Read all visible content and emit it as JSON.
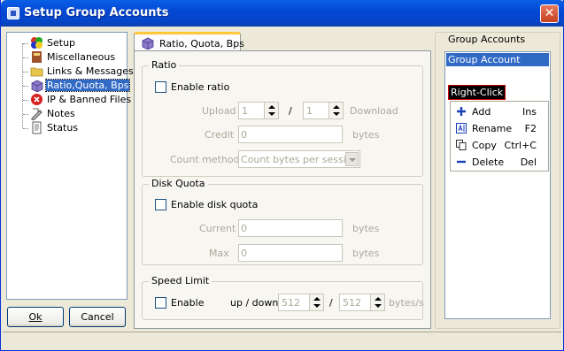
{
  "window": {
    "title": "Setup Group Accounts",
    "close_glyph": "✕"
  },
  "nav": {
    "items": [
      {
        "label": "Setup",
        "icon": "setup-icon"
      },
      {
        "label": "Miscellaneous",
        "icon": "book-icon"
      },
      {
        "label": "Links & Messages",
        "icon": "folder-icon"
      },
      {
        "label": "Ratio,Quota, Bps",
        "icon": "box-icon",
        "selected": true
      },
      {
        "label": "IP & Banned Files",
        "icon": "banned-icon"
      },
      {
        "label": "Notes",
        "icon": "notes-icon"
      },
      {
        "label": "Status",
        "icon": "status-icon"
      }
    ]
  },
  "buttons": {
    "ok": "Ok",
    "cancel": "Cancel"
  },
  "tab": {
    "label": "Ratio, Quota, Bps"
  },
  "ratio": {
    "legend": "Ratio",
    "enable_label": "Enable ratio",
    "upload_label": "Upload",
    "upload_value": "1",
    "separator": "/",
    "download_value": "1",
    "download_label": "Download",
    "credit_label": "Credit",
    "credit_value": "0",
    "credit_unit": "bytes",
    "count_method_label": "Count method",
    "count_method_value": "Count bytes per session"
  },
  "quota": {
    "legend": "Disk Quota",
    "enable_label": "Enable disk quota",
    "current_label": "Current",
    "current_value": "0",
    "current_unit": "bytes",
    "max_label": "Max",
    "max_value": "0",
    "max_unit": "bytes"
  },
  "speed": {
    "legend": "Speed Limit",
    "enable_label": "Enable",
    "updown_label": "up / down",
    "up_value": "512",
    "separator": "/",
    "down_value": "512",
    "unit": "bytes/s"
  },
  "accounts": {
    "legend": "Group Accounts",
    "items": [
      "Group Account"
    ],
    "right_click_label": "Right-Click",
    "menu": [
      {
        "label": "Add",
        "key": "Ins",
        "icon": "plus-icon",
        "color": "#1A3FB8"
      },
      {
        "label": "Rename",
        "key": "F2",
        "icon": "rename-icon",
        "color": "#1A3FB8"
      },
      {
        "label": "Copy",
        "key": "Ctrl+C",
        "icon": "copy-icon",
        "color": "#1A3FB8"
      },
      {
        "label": "Delete",
        "key": "Del",
        "icon": "minus-icon",
        "color": "#1A3FB8"
      }
    ]
  },
  "colors": {
    "accent": "#316AC5",
    "titlebar": "#0347D3",
    "legend": "#0046D5"
  }
}
